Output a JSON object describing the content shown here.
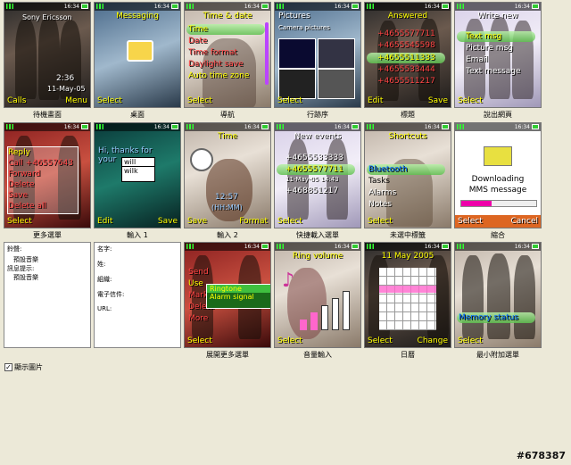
{
  "status_time": "16:34",
  "captions": [
    "待機畫面",
    "桌面",
    "導航",
    "行跡序",
    "標題",
    "說出網頁",
    "更多選單",
    "輸入 1",
    "輸入 2",
    "快捷載入選單",
    "未選中標籤",
    "縮合",
    "",
    "",
    "展開更多選單",
    "音量輸入",
    "日曆",
    "最小附加選單"
  ],
  "screens": {
    "s1": {
      "operator": "Sony Ericsson",
      "clock": "2:36",
      "date": "11-May-05",
      "soft_left": "Calls",
      "soft_right": "Menu"
    },
    "s2": {
      "title": "Messaging",
      "soft_left": "Select"
    },
    "s3": {
      "title": "Time & date",
      "items": [
        "Time",
        "Date",
        "Time format",
        "Daylight save",
        "Auto time zone"
      ],
      "soft_left": "Select"
    },
    "s4": {
      "title": "Pictures",
      "subtitle": "Camera pictures",
      "soft_left": "Select"
    },
    "s5": {
      "title": "Answered",
      "items": [
        "+4655577711",
        "+4655545598",
        "+4655511333",
        "+4655533444",
        "+4655511217"
      ],
      "soft_left": "Edit",
      "soft_right": "Save"
    },
    "s6": {
      "title": "Write new",
      "items": [
        "Text msg",
        "Picture msg",
        "Email",
        "Text message"
      ],
      "soft_left": "Select"
    },
    "s7": {
      "items": [
        "Reply",
        "Call +46557643",
        "Forward",
        "Delete",
        "Save",
        "Delete all"
      ],
      "soft_left": "Select"
    },
    "s8": {
      "text": "Hi, thanks for your",
      "suggest": [
        "will",
        "wilk"
      ],
      "soft_left": "Edit",
      "soft_right": "Save"
    },
    "s9": {
      "title": "Time",
      "clock": "12:57",
      "format": "(HH:MM)",
      "soft_left": "Save",
      "soft_right": "Format"
    },
    "s10": {
      "title": "New events",
      "items": [
        "+4655533333",
        "+4655577711",
        "11-May-05 14:43",
        "+468851217"
      ],
      "soft_left": "Select"
    },
    "s11": {
      "title": "Shortcuts",
      "items": [
        "Bluetooth",
        "Tasks",
        "Alarms",
        "Notes"
      ],
      "soft_left": "Select"
    },
    "s12": {
      "line1": "Downloading",
      "line2": "MMS message",
      "soft_left": "Select",
      "soft_right": "Cancel"
    },
    "s15": {
      "items": [
        "Send",
        "Use",
        "Mark",
        "Delete",
        "More"
      ],
      "popup": [
        "Ringtone",
        "Alarm signal"
      ],
      "soft_left": "Select"
    },
    "s16": {
      "title": "Ring volume",
      "soft_left": "Select"
    },
    "s17": {
      "title": "11 May 2005",
      "soft_left": "Select",
      "soft_right": "Change"
    },
    "s18": {
      "label": "Memory status",
      "soft_left": "Select"
    }
  },
  "panel1": {
    "lines": [
      "鈴聲:",
      "預設音樂",
      "訊息提示:",
      "預設音樂"
    ]
  },
  "panel2": {
    "lines": [
      "名字:",
      "姓:",
      "組織:",
      "電子信件:",
      "URL:"
    ]
  },
  "show_images_label": "顯示圖片",
  "watermark": "#678387",
  "accent_yellow": "#ffff00",
  "highlight_green": "#5fc050"
}
